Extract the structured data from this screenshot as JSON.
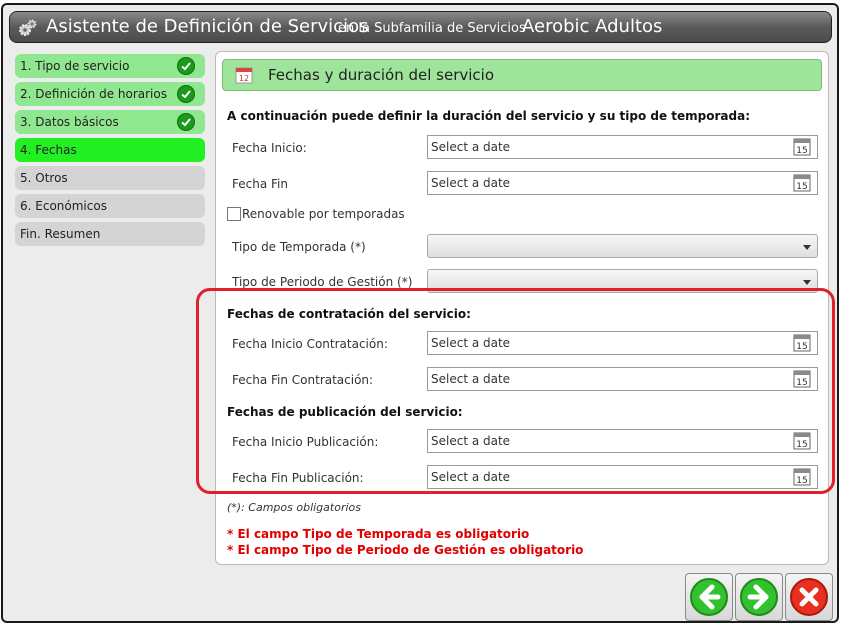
{
  "title": {
    "main": "Asistente de Definición de Servicios",
    "subfamily_prefix": "en la Subfamilia de Servicios",
    "service_name": "Aerobic Adultos"
  },
  "steps": [
    {
      "label": "1. Tipo de servicio",
      "state": "done"
    },
    {
      "label": "2. Definición de horarios",
      "state": "done"
    },
    {
      "label": "3. Datos básicos",
      "state": "done"
    },
    {
      "label": "4. Fechas",
      "state": "active"
    },
    {
      "label": "5. Otros",
      "state": "pending"
    },
    {
      "label": "6. Económicos",
      "state": "pending"
    },
    {
      "label": "Fin. Resumen",
      "state": "pending"
    }
  ],
  "panel": {
    "header": "Fechas y duración del servicio",
    "intro": "A continuación puede definir la duración del servicio y su tipo de temporada:",
    "fecha_inicio_label": "Fecha Inicio:",
    "fecha_fin_label": "Fecha Fin",
    "date_placeholder": "Select a date",
    "renovable_label": "Renovable por temporadas",
    "tipo_temporada_label": "Tipo de Temporada (*)",
    "tipo_periodo_label": "Tipo de Periodo de Gestión (*)",
    "contratacion_title": "Fechas de contratación del servicio:",
    "inicio_contratacion_label": "Fecha Inicio Contratación:",
    "fin_contratacion_label": "Fecha Fin Contratación:",
    "publicacion_title": "Fechas de publicación del servicio:",
    "inicio_publicacion_label": "Fecha Inicio Publicación:",
    "fin_publicacion_label": "Fecha Fin Publicación:",
    "required_note": "(*): Campos obligatorios",
    "error_temporada": "* El campo Tipo de Temporada es obligatorio",
    "error_periodo": "* El campo Tipo de Periodo de Gestión es obligatorio",
    "calendar_day": "15",
    "header_icon_day": "12"
  },
  "icons": {
    "title": "gear-icon",
    "step_done": "checkmark-icon",
    "date_picker": "calendar-icon",
    "back": "arrow-left-icon",
    "next": "arrow-right-icon",
    "cancel": "close-icon"
  },
  "colors": {
    "step_done": "#8fe78f",
    "step_active": "#22f022",
    "step_pending": "#d4d4d4",
    "header_bg": "#9fe49b",
    "error_text": "#e00000",
    "highlight_box": "#e0202a"
  }
}
